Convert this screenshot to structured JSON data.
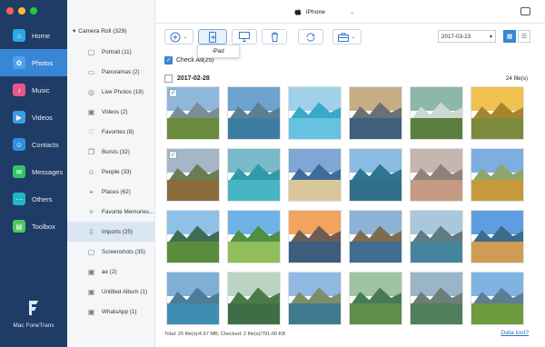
{
  "colors": {
    "nav_bg": "#1f3c66",
    "nav_active": "#3a86d6",
    "accent": "#3a86d6",
    "link": "#2f6fc2"
  },
  "window_controls": [
    {
      "name": "close",
      "color": "#ff5f57"
    },
    {
      "name": "minimize",
      "color": "#febc2e"
    },
    {
      "name": "zoom",
      "color": "#28c840"
    }
  ],
  "nav": {
    "items": [
      {
        "label": "Home",
        "icon": "home-icon",
        "color": "#2aa7e8"
      },
      {
        "label": "Photos",
        "icon": "photos-icon",
        "color": "#4aa3ec",
        "active": true
      },
      {
        "label": "Music",
        "icon": "music-icon",
        "color": "#e9558b"
      },
      {
        "label": "Videos",
        "icon": "videos-icon",
        "color": "#3a9be6"
      },
      {
        "label": "Contacts",
        "icon": "contacts-icon",
        "color": "#2f8fe0"
      },
      {
        "label": "Messages",
        "icon": "messages-icon",
        "color": "#34c36a"
      },
      {
        "label": "Others",
        "icon": "others-icon",
        "color": "#20b6c9"
      },
      {
        "label": "Toolbox",
        "icon": "toolbox-icon",
        "color": "#4cc85a"
      }
    ],
    "brand": "Mac FoneTrans"
  },
  "albums": {
    "root": "Camera Roll (329)",
    "items": [
      {
        "label": "Portrait (11)",
        "icon": "portrait-album-icon"
      },
      {
        "label": "Panoramas (2)",
        "icon": "panorama-album-icon"
      },
      {
        "label": "Live Photos (18)",
        "icon": "live-photos-icon"
      },
      {
        "label": "Videos (2)",
        "icon": "videos-album-icon"
      },
      {
        "label": "Favorites (8)",
        "icon": "heart-icon"
      },
      {
        "label": "Bursts (32)",
        "icon": "bursts-icon"
      },
      {
        "label": "People (33)",
        "icon": "people-icon"
      },
      {
        "label": "Places (62)",
        "icon": "places-icon"
      },
      {
        "label": "Favorite Memories...",
        "icon": "memories-icon"
      },
      {
        "label": "Imports (25)",
        "icon": "imports-icon",
        "active": true
      },
      {
        "label": "Screenshots (35)",
        "icon": "screenshots-icon"
      },
      {
        "label": "ae (2)",
        "icon": "album-icon"
      },
      {
        "label": "Untitled Album (1)",
        "icon": "album-icon"
      },
      {
        "label": "WhatsApp (1)",
        "icon": "album-icon"
      }
    ]
  },
  "device": {
    "name": "iPhone"
  },
  "toolbar": {
    "tooltip": "iPad",
    "date": "2017-03-23"
  },
  "main": {
    "check_all": "Check All(25)",
    "date_group": "2017-02-28",
    "file_count": "24 file(s)"
  },
  "photos": [
    {
      "checked": true,
      "sky": "#8fb7dc",
      "mtn": "#7d8d96",
      "ground": "#6a8b3d"
    },
    {
      "checked": false,
      "sky": "#6fa3cf",
      "mtn": "#5d7f93",
      "ground": "#3d7da3"
    },
    {
      "checked": false,
      "sky": "#9fd2ea",
      "mtn": "#3aa8c8",
      "ground": "#66c2e0"
    },
    {
      "checked": false,
      "sky": "#c7ad84",
      "mtn": "#6b7076",
      "ground": "#3f5f7c"
    },
    {
      "checked": false,
      "sky": "#8cb8aa",
      "mtn": "#cfd7d2",
      "ground": "#5a7f3e"
    },
    {
      "checked": false,
      "sky": "#f0c14f",
      "mtn": "#a6852e",
      "ground": "#7d8a3d"
    },
    {
      "checked": true,
      "sky": "#a5b7c7",
      "mtn": "#6a7c55",
      "ground": "#8b6c3c"
    },
    {
      "checked": false,
      "sky": "#79b9c9",
      "mtn": "#2f9aa8",
      "ground": "#48b6c2"
    },
    {
      "checked": false,
      "sky": "#7ea8d3",
      "mtn": "#3e6b98",
      "ground": "#d9c79a"
    },
    {
      "checked": false,
      "sky": "#8bbbe0",
      "mtn": "#2e7592",
      "ground": "#2f6f88"
    },
    {
      "checked": false,
      "sky": "#c7b6b0",
      "mtn": "#8e8178",
      "ground": "#c49a82"
    },
    {
      "checked": false,
      "sky": "#7eaee0",
      "mtn": "#8ea66a",
      "ground": "#c69a3b"
    },
    {
      "checked": false,
      "sky": "#8fc1e6",
      "mtn": "#3e6c55",
      "ground": "#5a8c3d"
    },
    {
      "checked": false,
      "sky": "#6fb3e6",
      "mtn": "#4f8f44",
      "ground": "#8fbe5a"
    },
    {
      "checked": false,
      "sky": "#f2a45e",
      "mtn": "#6e5c55",
      "ground": "#3e5d7e"
    },
    {
      "checked": false,
      "sky": "#8cb3d6",
      "mtn": "#7d6c4e",
      "ground": "#3f6e8f"
    },
    {
      "checked": false,
      "sky": "#a9c7dd",
      "mtn": "#5f7a82",
      "ground": "#46839c"
    },
    {
      "checked": false,
      "sky": "#5e9ee0",
      "mtn": "#3d6b8c",
      "ground": "#cf9b56"
    },
    {
      "checked": false,
      "sky": "#7faed6",
      "mtn": "#4e7b95",
      "ground": "#3f8db0"
    },
    {
      "checked": false,
      "sky": "#b9d4c2",
      "mtn": "#4b7a48",
      "ground": "#3f6e46"
    },
    {
      "checked": false,
      "sky": "#8fb9e2",
      "mtn": "#7a8f6a",
      "ground": "#3f7a8f"
    },
    {
      "checked": false,
      "sky": "#9fc3a3",
      "mtn": "#477a52",
      "ground": "#5d8f4a"
    },
    {
      "checked": false,
      "sky": "#9bb5c8",
      "mtn": "#6d7f74",
      "ground": "#4f7f5b"
    },
    {
      "checked": false,
      "sky": "#7fb4e2",
      "mtn": "#5c7d92",
      "ground": "#6e9a3e"
    }
  ],
  "status": {
    "summary": "Total: 25 file(s)/4.57 MB; Checked: 2 file(s)/791.00 KB",
    "data_lost": "Data lost?"
  }
}
